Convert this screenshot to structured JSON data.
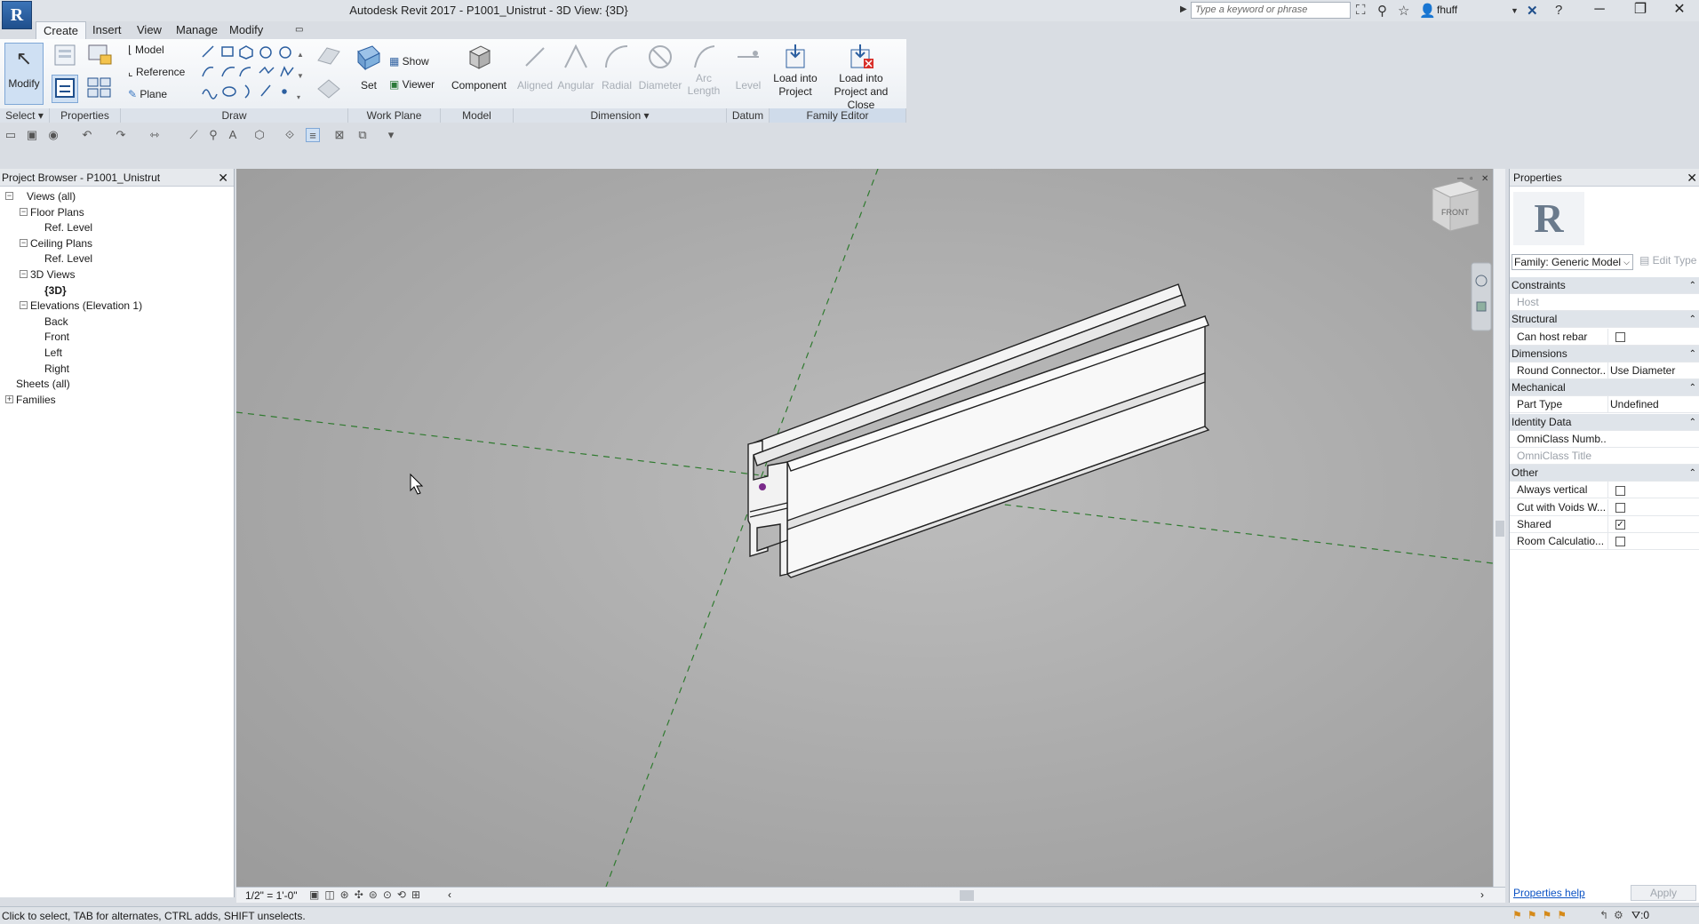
{
  "app": {
    "title": "Autodesk Revit 2017 -    P1001_Unistrut - 3D View: {3D}",
    "logo": "R",
    "search_placeholder": "Type a keyword or phrase",
    "user": "fhuff"
  },
  "ribbon": {
    "tabs": [
      "Create",
      "Insert",
      "View",
      "Manage",
      "Modify"
    ],
    "active_tab": "Create",
    "modify_label": "Modify",
    "select_label": "Select",
    "panels": {
      "properties": "Properties",
      "draw": "Draw",
      "work_plane": "Work Plane",
      "model": "Model",
      "dimension": "Dimension",
      "datum": "Datum",
      "family_editor": "Family Editor"
    },
    "draw_buttons": [
      "Model",
      "Reference",
      "Plane"
    ],
    "workplane_buttons": {
      "set": "Set",
      "show": "Show",
      "viewer": "Viewer"
    },
    "component": "Component",
    "dimension_buttons": [
      "Aligned",
      "Angular",
      "Radial",
      "Diameter",
      "Arc Length"
    ],
    "level": "Level",
    "load_into_project": "Load into Project",
    "load_into_project_close": "Load into Project and Close"
  },
  "project_browser": {
    "title": "Project Browser - P1001_Unistrut",
    "items": [
      {
        "label": "Views (all)",
        "depth": 0,
        "expander": "−"
      },
      {
        "label": "Floor Plans",
        "depth": 1,
        "expander": "−"
      },
      {
        "label": "Ref. Level",
        "depth": 2,
        "expander": ""
      },
      {
        "label": "Ceiling Plans",
        "depth": 1,
        "expander": "−"
      },
      {
        "label": "Ref. Level",
        "depth": 2,
        "expander": ""
      },
      {
        "label": "3D Views",
        "depth": 1,
        "expander": "−"
      },
      {
        "label": "{3D}",
        "depth": 2,
        "expander": "",
        "bold": true
      },
      {
        "label": "Elevations (Elevation 1)",
        "depth": 1,
        "expander": "−"
      },
      {
        "label": "Back",
        "depth": 2,
        "expander": ""
      },
      {
        "label": "Front",
        "depth": 2,
        "expander": ""
      },
      {
        "label": "Left",
        "depth": 2,
        "expander": ""
      },
      {
        "label": "Right",
        "depth": 2,
        "expander": ""
      },
      {
        "label": "Sheets (all)",
        "depth": 0,
        "expander": ""
      },
      {
        "label": "Families",
        "depth": 0,
        "expander": "+"
      }
    ]
  },
  "viewport": {
    "viewcube_label": "FRONT",
    "scale": "1/2\" = 1'-0\""
  },
  "properties": {
    "title": "Properties",
    "type_icon": "R",
    "family": "Family: Generic Model",
    "edit_type": "Edit Type",
    "rows": [
      {
        "kind": "group",
        "name": "Constraints"
      },
      {
        "kind": "prop",
        "name": "Host",
        "value": "",
        "dim": true
      },
      {
        "kind": "group",
        "name": "Structural"
      },
      {
        "kind": "prop",
        "name": "Can host rebar",
        "check": "unchecked"
      },
      {
        "kind": "group",
        "name": "Dimensions"
      },
      {
        "kind": "prop",
        "name": "Round Connector...",
        "value": "Use Diameter"
      },
      {
        "kind": "group",
        "name": "Mechanical"
      },
      {
        "kind": "prop",
        "name": "Part Type",
        "value": "Undefined"
      },
      {
        "kind": "group",
        "name": "Identity Data"
      },
      {
        "kind": "prop",
        "name": "OmniClass Numb...",
        "value": ""
      },
      {
        "kind": "prop",
        "name": "OmniClass Title",
        "value": "",
        "dim": true
      },
      {
        "kind": "group",
        "name": "Other"
      },
      {
        "kind": "prop",
        "name": "Always vertical",
        "check": "unchecked"
      },
      {
        "kind": "prop",
        "name": "Cut with Voids W...",
        "check": "unchecked"
      },
      {
        "kind": "prop",
        "name": "Shared",
        "check": "checked"
      },
      {
        "kind": "prop",
        "name": "Room Calculatio...",
        "check": "unchecked"
      }
    ],
    "help": "Properties help",
    "apply": "Apply"
  },
  "status": {
    "text": "Click to select, TAB for alternates, CTRL adds, SHIFT unselects.",
    "filter_count": ":0"
  }
}
